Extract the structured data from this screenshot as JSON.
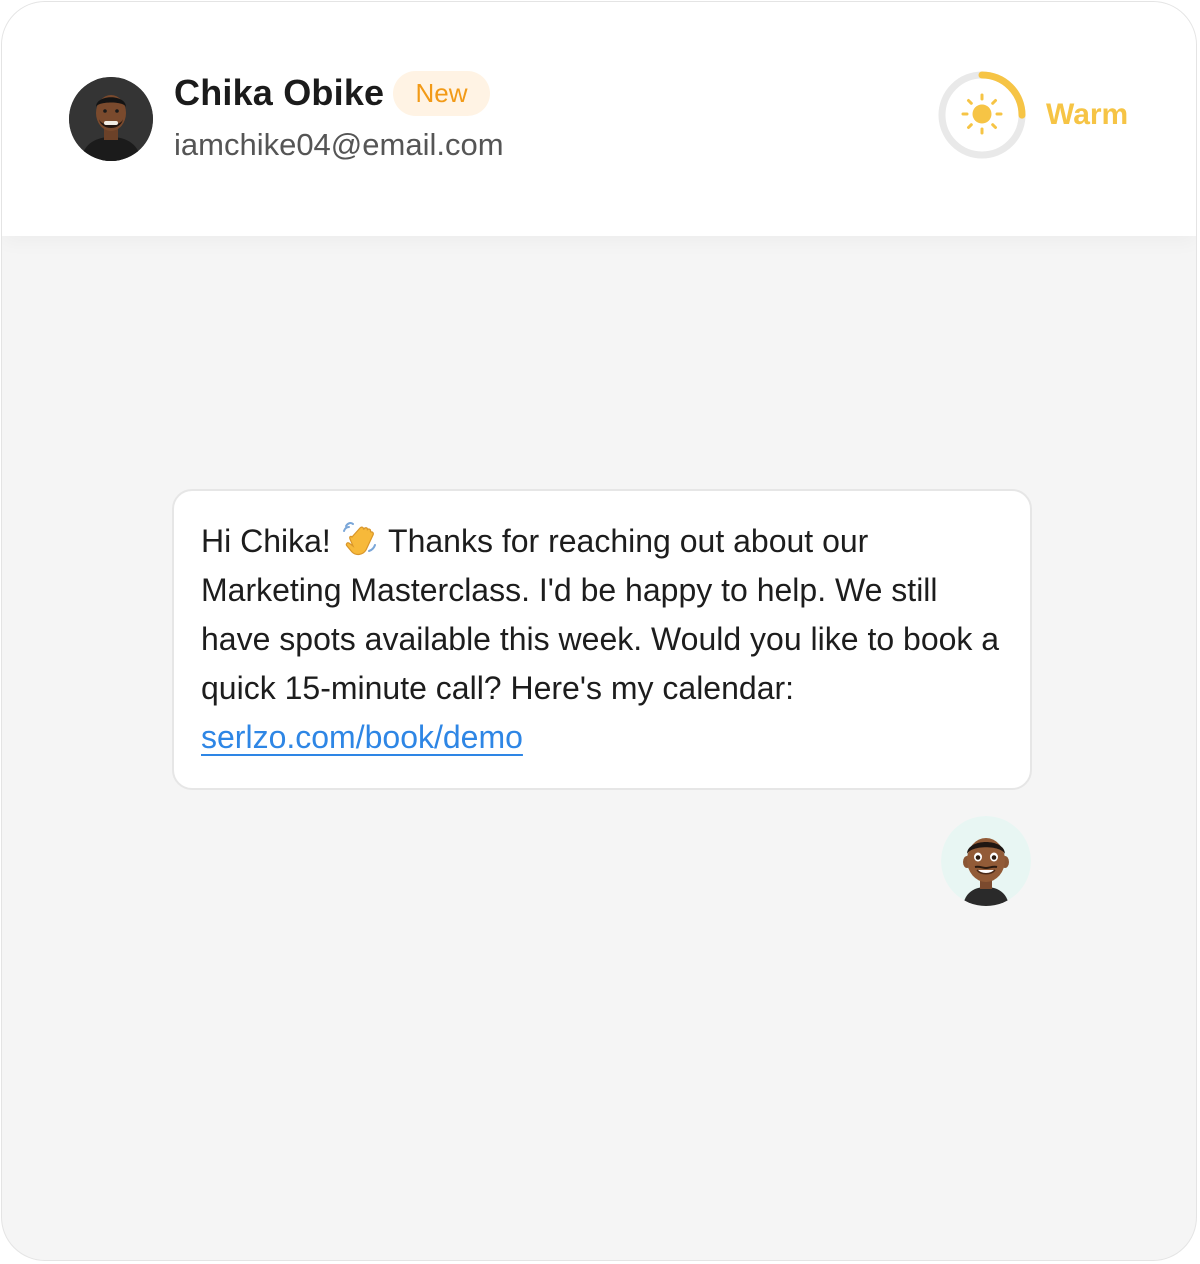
{
  "contact": {
    "name": "Chika Obike",
    "badge": "New",
    "email": "iamchike04@email.com",
    "avatar_icon": "person-avatar-icon"
  },
  "lead_temperature": {
    "label": "Warm",
    "icon": "sun-icon",
    "progress_percent": 25,
    "color": "#f6c445"
  },
  "message": {
    "before_emoji": "Hi Chika! ",
    "emoji_icon": "waving-hand-icon",
    "after_emoji": " Thanks for reaching out about our Marketing Masterclass. I'd be happy to help. We still have spots available this week. Would you like to book a quick 15-minute call? Here's my calendar: ",
    "link_text": "serlzo.com/book/demo",
    "sender_avatar_icon": "agent-avatar-icon"
  },
  "colors": {
    "link": "#2e86e5",
    "badge_text": "#f29a17",
    "badge_bg": "#fff3e4",
    "background": "#f5f5f5"
  }
}
